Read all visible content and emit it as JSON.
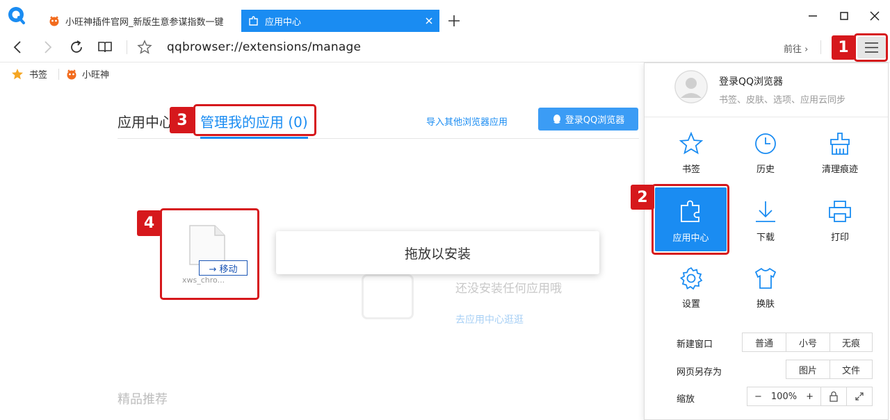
{
  "tabs": {
    "inactive_title": "小旺神插件官网_新版生意参谋指数一键",
    "active_title": "应用中心"
  },
  "address": {
    "url": "qqbrowser://extensions/manage",
    "goto": "前往 ›"
  },
  "bookmarks": [
    {
      "label": "书签"
    },
    {
      "label": "小旺神"
    }
  ],
  "page": {
    "tab_app_center": "应用中心",
    "tab_manage": "管理我的应用 (0)",
    "import_link": "导入其他浏览器应用",
    "login_button": "登录QQ浏览器",
    "drop_label": "拖放以安装",
    "empty_text": "还没安装任何应用哦",
    "go_center_link": "去应用中心逛逛",
    "file_name": "xws_chro...",
    "move_label": "→ 移动",
    "recommend_title": "精品推荐"
  },
  "callouts": [
    "1",
    "2",
    "3",
    "4"
  ],
  "menu": {
    "login_title": "登录QQ浏览器",
    "login_sub": "书签、皮肤、选项、应用云同步",
    "items": [
      {
        "label": "书签",
        "icon": "star-icon"
      },
      {
        "label": "历史",
        "icon": "clock-icon"
      },
      {
        "label": "清理痕迹",
        "icon": "broom-icon"
      },
      {
        "label": "应用中心",
        "icon": "puzzle-icon"
      },
      {
        "label": "下载",
        "icon": "download-icon"
      },
      {
        "label": "打印",
        "icon": "printer-icon"
      },
      {
        "label": "设置",
        "icon": "gear-icon"
      },
      {
        "label": "换肤",
        "icon": "shirt-icon"
      }
    ],
    "new_window_label": "新建窗口",
    "new_window_options": [
      "普通",
      "小号",
      "无痕"
    ],
    "save_as_label": "网页另存为",
    "save_as_options": [
      "图片",
      "文件"
    ],
    "zoom_label": "缩放",
    "zoom_value": "100%",
    "zoom_minus": "−",
    "zoom_plus": "+"
  },
  "colors": {
    "accent": "#1a8cf2",
    "callout_red": "#d6181c"
  }
}
